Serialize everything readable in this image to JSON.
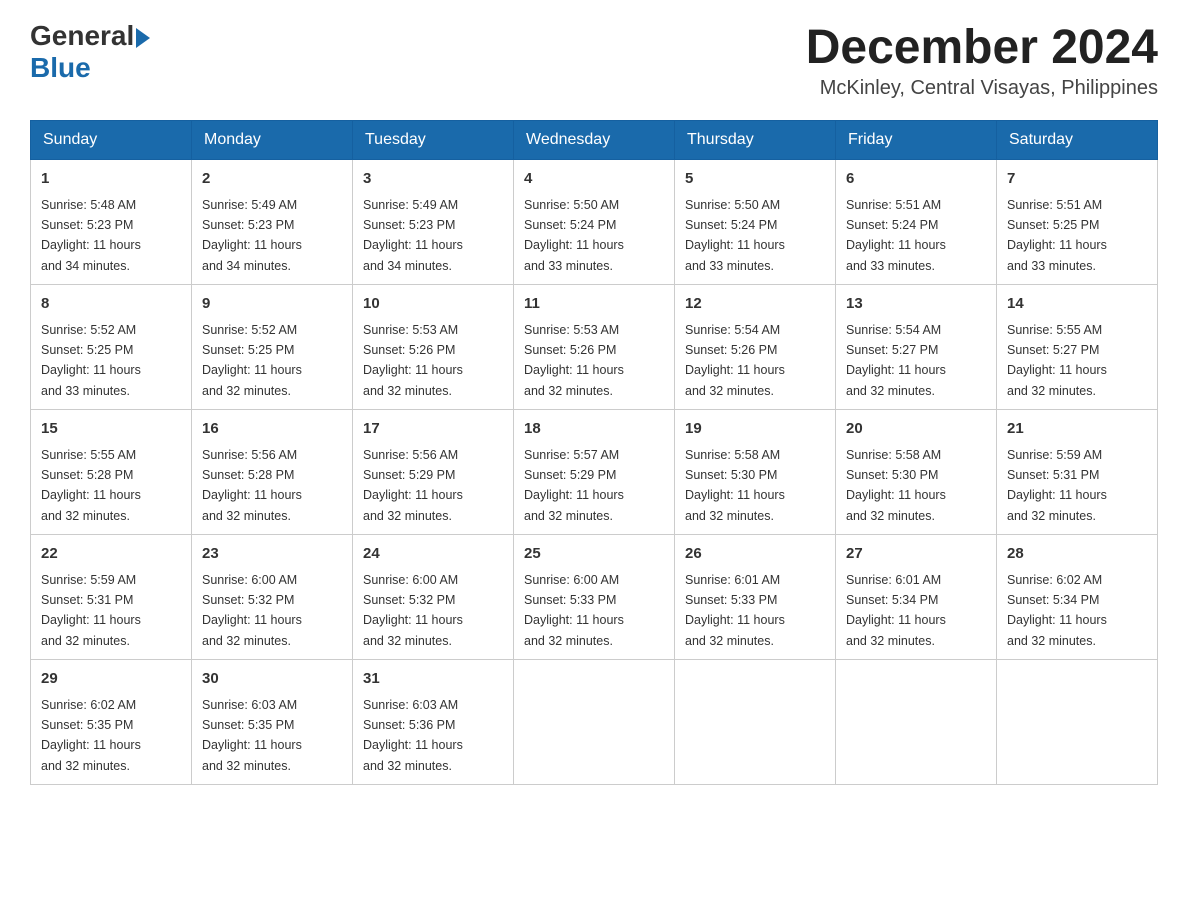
{
  "header": {
    "logo_general": "General",
    "logo_blue": "Blue",
    "month_title": "December 2024",
    "location": "McKinley, Central Visayas, Philippines"
  },
  "days_of_week": [
    "Sunday",
    "Monday",
    "Tuesday",
    "Wednesday",
    "Thursday",
    "Friday",
    "Saturday"
  ],
  "weeks": [
    [
      {
        "day": "1",
        "sunrise": "5:48 AM",
        "sunset": "5:23 PM",
        "daylight": "11 hours and 34 minutes."
      },
      {
        "day": "2",
        "sunrise": "5:49 AM",
        "sunset": "5:23 PM",
        "daylight": "11 hours and 34 minutes."
      },
      {
        "day": "3",
        "sunrise": "5:49 AM",
        "sunset": "5:23 PM",
        "daylight": "11 hours and 34 minutes."
      },
      {
        "day": "4",
        "sunrise": "5:50 AM",
        "sunset": "5:24 PM",
        "daylight": "11 hours and 33 minutes."
      },
      {
        "day": "5",
        "sunrise": "5:50 AM",
        "sunset": "5:24 PM",
        "daylight": "11 hours and 33 minutes."
      },
      {
        "day": "6",
        "sunrise": "5:51 AM",
        "sunset": "5:24 PM",
        "daylight": "11 hours and 33 minutes."
      },
      {
        "day": "7",
        "sunrise": "5:51 AM",
        "sunset": "5:25 PM",
        "daylight": "11 hours and 33 minutes."
      }
    ],
    [
      {
        "day": "8",
        "sunrise": "5:52 AM",
        "sunset": "5:25 PM",
        "daylight": "11 hours and 33 minutes."
      },
      {
        "day": "9",
        "sunrise": "5:52 AM",
        "sunset": "5:25 PM",
        "daylight": "11 hours and 32 minutes."
      },
      {
        "day": "10",
        "sunrise": "5:53 AM",
        "sunset": "5:26 PM",
        "daylight": "11 hours and 32 minutes."
      },
      {
        "day": "11",
        "sunrise": "5:53 AM",
        "sunset": "5:26 PM",
        "daylight": "11 hours and 32 minutes."
      },
      {
        "day": "12",
        "sunrise": "5:54 AM",
        "sunset": "5:26 PM",
        "daylight": "11 hours and 32 minutes."
      },
      {
        "day": "13",
        "sunrise": "5:54 AM",
        "sunset": "5:27 PM",
        "daylight": "11 hours and 32 minutes."
      },
      {
        "day": "14",
        "sunrise": "5:55 AM",
        "sunset": "5:27 PM",
        "daylight": "11 hours and 32 minutes."
      }
    ],
    [
      {
        "day": "15",
        "sunrise": "5:55 AM",
        "sunset": "5:28 PM",
        "daylight": "11 hours and 32 minutes."
      },
      {
        "day": "16",
        "sunrise": "5:56 AM",
        "sunset": "5:28 PM",
        "daylight": "11 hours and 32 minutes."
      },
      {
        "day": "17",
        "sunrise": "5:56 AM",
        "sunset": "5:29 PM",
        "daylight": "11 hours and 32 minutes."
      },
      {
        "day": "18",
        "sunrise": "5:57 AM",
        "sunset": "5:29 PM",
        "daylight": "11 hours and 32 minutes."
      },
      {
        "day": "19",
        "sunrise": "5:58 AM",
        "sunset": "5:30 PM",
        "daylight": "11 hours and 32 minutes."
      },
      {
        "day": "20",
        "sunrise": "5:58 AM",
        "sunset": "5:30 PM",
        "daylight": "11 hours and 32 minutes."
      },
      {
        "day": "21",
        "sunrise": "5:59 AM",
        "sunset": "5:31 PM",
        "daylight": "11 hours and 32 minutes."
      }
    ],
    [
      {
        "day": "22",
        "sunrise": "5:59 AM",
        "sunset": "5:31 PM",
        "daylight": "11 hours and 32 minutes."
      },
      {
        "day": "23",
        "sunrise": "6:00 AM",
        "sunset": "5:32 PM",
        "daylight": "11 hours and 32 minutes."
      },
      {
        "day": "24",
        "sunrise": "6:00 AM",
        "sunset": "5:32 PM",
        "daylight": "11 hours and 32 minutes."
      },
      {
        "day": "25",
        "sunrise": "6:00 AM",
        "sunset": "5:33 PM",
        "daylight": "11 hours and 32 minutes."
      },
      {
        "day": "26",
        "sunrise": "6:01 AM",
        "sunset": "5:33 PM",
        "daylight": "11 hours and 32 minutes."
      },
      {
        "day": "27",
        "sunrise": "6:01 AM",
        "sunset": "5:34 PM",
        "daylight": "11 hours and 32 minutes."
      },
      {
        "day": "28",
        "sunrise": "6:02 AM",
        "sunset": "5:34 PM",
        "daylight": "11 hours and 32 minutes."
      }
    ],
    [
      {
        "day": "29",
        "sunrise": "6:02 AM",
        "sunset": "5:35 PM",
        "daylight": "11 hours and 32 minutes."
      },
      {
        "day": "30",
        "sunrise": "6:03 AM",
        "sunset": "5:35 PM",
        "daylight": "11 hours and 32 minutes."
      },
      {
        "day": "31",
        "sunrise": "6:03 AM",
        "sunset": "5:36 PM",
        "daylight": "11 hours and 32 minutes."
      },
      null,
      null,
      null,
      null
    ]
  ],
  "labels": {
    "sunrise": "Sunrise:",
    "sunset": "Sunset:",
    "daylight": "Daylight:"
  }
}
